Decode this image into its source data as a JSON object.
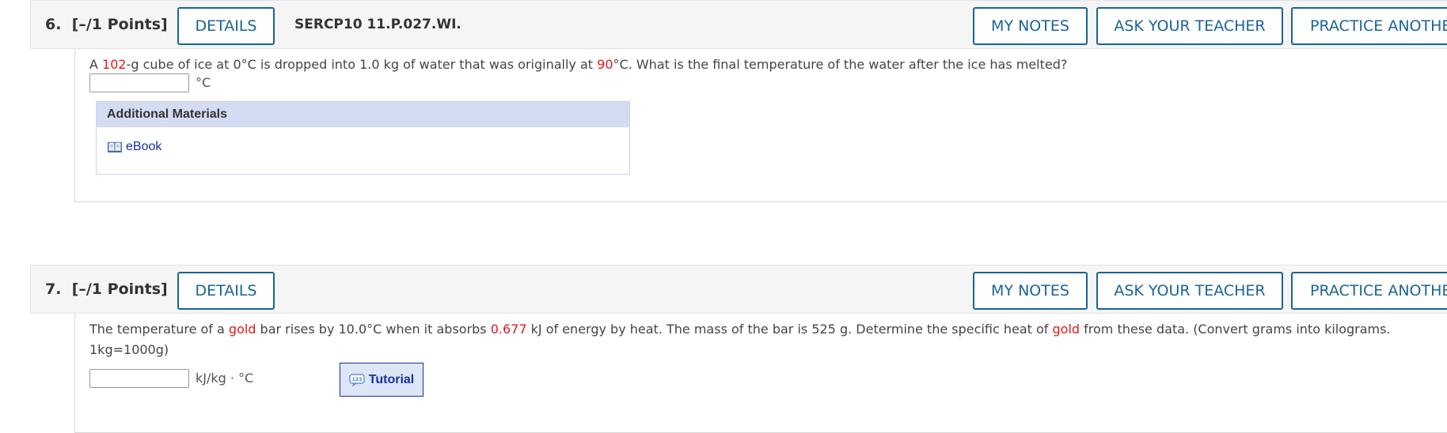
{
  "questions": [
    {
      "number": "6.",
      "points": "[–/1 Points]",
      "details_label": "DETAILS",
      "code": "SERCP10 11.P.027.WI.",
      "my_notes_label": "MY NOTES",
      "ask_teacher_label": "ASK YOUR TEACHER",
      "practice_label": "PRACTICE ANOTHER",
      "text": {
        "p1": "A ",
        "mass": "102",
        "p2": "-g cube of ice at 0°C is dropped into 1.0 kg of water that was originally at ",
        "temp": "90",
        "p3": "°C. What is the final temperature of the water after the ice has melted?"
      },
      "answer_value": "",
      "unit": "°C",
      "additional_materials": {
        "title": "Additional Materials",
        "ebook_label": "eBook"
      }
    },
    {
      "number": "7.",
      "points": "[–/1 Points]",
      "details_label": "DETAILS",
      "my_notes_label": "MY NOTES",
      "ask_teacher_label": "ASK YOUR TEACHER",
      "practice_label": "PRACTICE ANOTHER",
      "text": {
        "p1": "The temperature of a ",
        "metal1": "gold",
        "p2": " bar rises by 10.0°C when it absorbs ",
        "energy": "0.677",
        "p3": " kJ of energy by heat. The mass of the bar is 525 g. Determine the specific heat of ",
        "metal2": "gold",
        "p4": " from these data. (Convert grams into kilograms.",
        "line2": "1kg=1000g)"
      },
      "answer_value": "",
      "unit": "kJ/kg · °C",
      "tutorial_label": "Tutorial"
    }
  ],
  "colors": {
    "button_border": "#1a6496",
    "highlight_red": "#e4181b",
    "link_blue": "#1a2fa6",
    "materials_header": "#d3dcf2"
  },
  "icons": [
    "book-icon",
    "tutorial-icon"
  ]
}
